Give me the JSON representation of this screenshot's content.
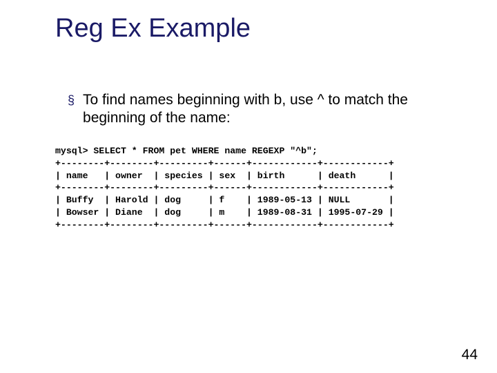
{
  "title": "Reg Ex Example",
  "bullet": {
    "marker": "§",
    "text": "To find names beginning with b, use ^ to match the beginning of the name:"
  },
  "code": "mysql> SELECT * FROM pet WHERE name REGEXP \"^b\";\n+--------+--------+---------+------+------------+------------+\n| name   | owner  | species | sex  | birth      | death      |\n+--------+--------+---------+------+------------+------------+\n| Buffy  | Harold | dog     | f    | 1989-05-13 | NULL       |\n| Bowser | Diane  | dog     | m    | 1989-08-31 | 1995-07-29 |\n+--------+--------+---------+------+------------+------------+",
  "page_number": "44"
}
